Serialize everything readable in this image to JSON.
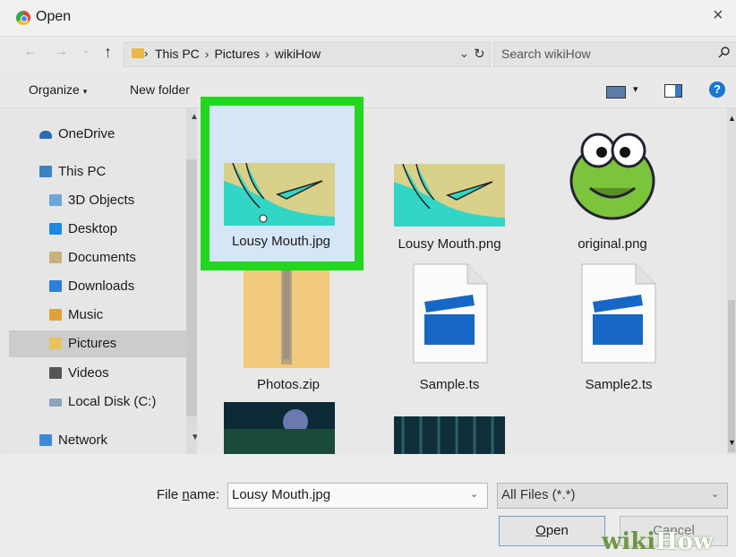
{
  "window": {
    "title": "Open",
    "close_glyph": "×"
  },
  "address": {
    "crumbs": [
      "This PC",
      "Pictures",
      "wikiHow"
    ],
    "search_placeholder": "Search wikiHow"
  },
  "toolbar": {
    "organize": "Organize",
    "new_folder": "New folder"
  },
  "sidebar": {
    "items": [
      {
        "label": "OneDrive",
        "icon": "cloud-icon"
      },
      {
        "label": "This PC",
        "icon": "computer-icon"
      },
      {
        "label": "3D Objects",
        "icon": "3d-objects-icon"
      },
      {
        "label": "Desktop",
        "icon": "desktop-icon"
      },
      {
        "label": "Documents",
        "icon": "documents-icon"
      },
      {
        "label": "Downloads",
        "icon": "downloads-icon"
      },
      {
        "label": "Music",
        "icon": "music-icon"
      },
      {
        "label": "Pictures",
        "icon": "pictures-icon",
        "selected": true
      },
      {
        "label": "Videos",
        "icon": "videos-icon"
      },
      {
        "label": "Local Disk (C:)",
        "icon": "disk-icon"
      },
      {
        "label": "Network",
        "icon": "network-icon"
      }
    ]
  },
  "files": [
    {
      "name": "Lousy Mouth.jpg",
      "type": "image",
      "selected": true
    },
    {
      "name": "Lousy Mouth.png",
      "type": "image"
    },
    {
      "name": "original.png",
      "type": "image"
    },
    {
      "name": "Photos.zip",
      "type": "zip"
    },
    {
      "name": "Sample.ts",
      "type": "video"
    },
    {
      "name": "Sample2.ts",
      "type": "video"
    },
    {
      "name": "",
      "type": "image"
    },
    {
      "name": "",
      "type": "image"
    }
  ],
  "bottom": {
    "file_name_label": "File name:",
    "file_name_label_prefix": "File ",
    "file_name_label_u": "n",
    "file_name_label_rest": "ame:",
    "file_name_value": "Lousy Mouth.jpg",
    "file_type_value": "All Files (*.*)",
    "open_label": "Open",
    "open_label_u": "O",
    "open_label_rest": "pen",
    "cancel_label": "Cancel"
  },
  "watermark": {
    "prefix": "wiki",
    "suffix": "How"
  },
  "colors": {
    "highlight": "#23d61e",
    "selection": "#d4e6f8",
    "accent": "#1976d2"
  }
}
